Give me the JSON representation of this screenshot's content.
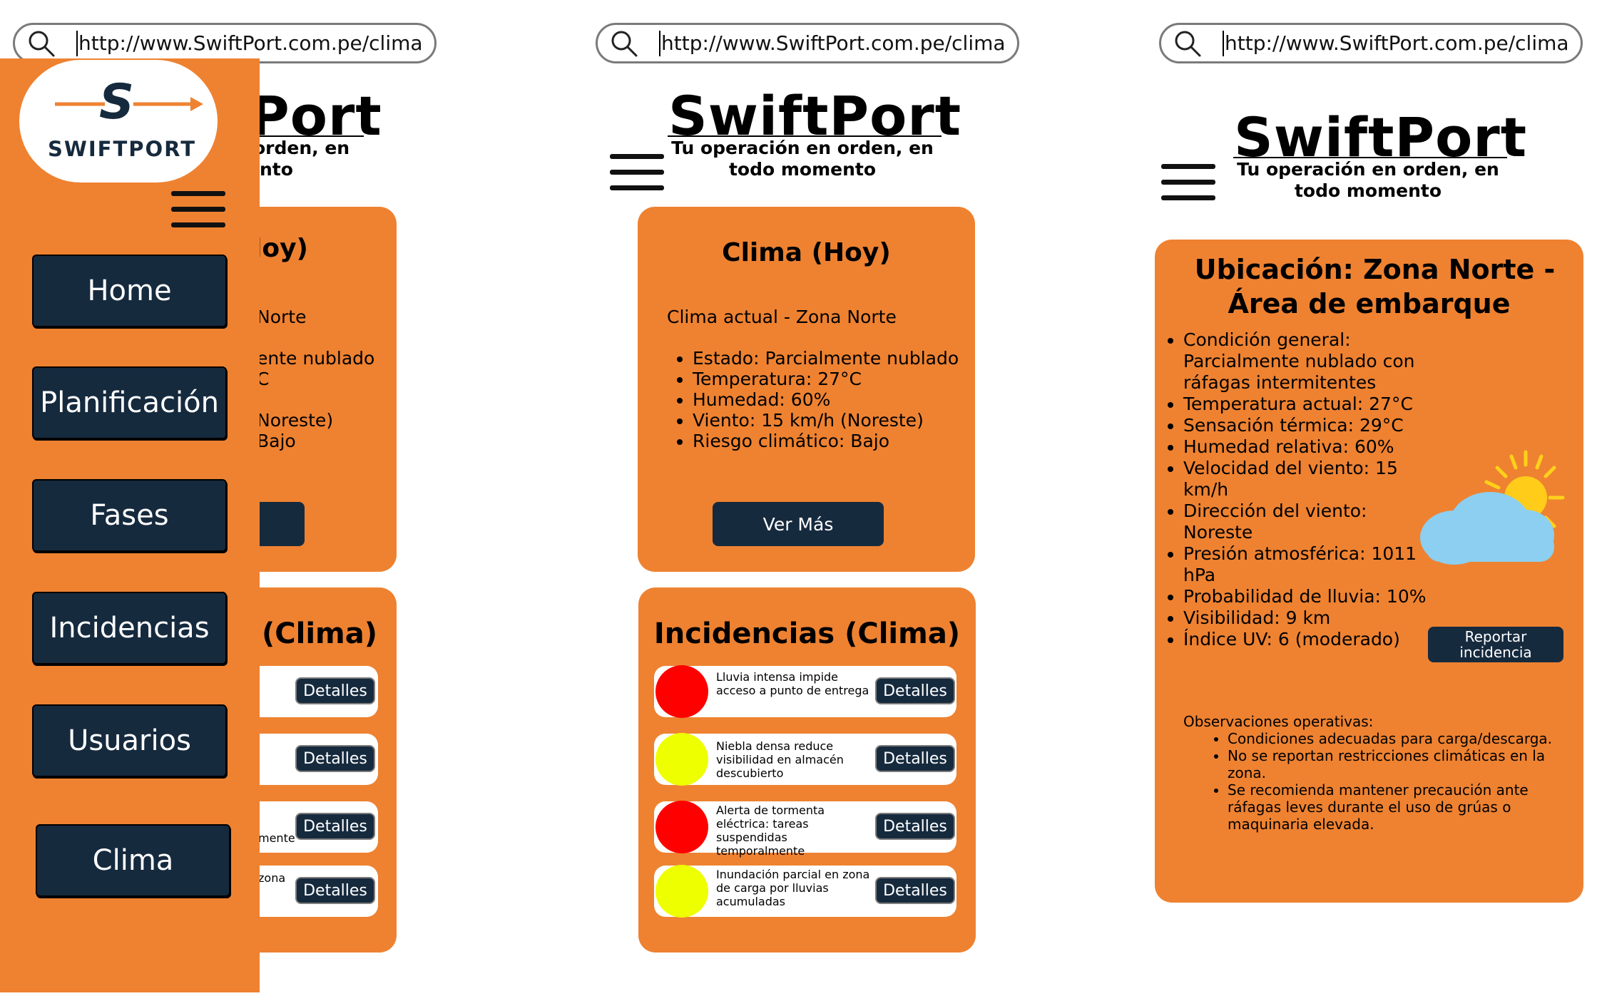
{
  "url": "http://www.SwiftPort.com.pe/clima",
  "brand": {
    "name": "SwiftPort",
    "tagline_line1": "Tu operación en orden, en",
    "tagline_line2": "todo momento",
    "logo_letter": "S",
    "logo_text": "SWIFTPORT"
  },
  "menu": {
    "items": [
      "Home",
      "Planificación",
      "Fases",
      "Incidencias",
      "Usuarios",
      "Clima"
    ]
  },
  "weather_card": {
    "title": "Clima (Hoy)",
    "subtitle": "Clima actual - Zona Norte",
    "items": [
      "Estado:  Parcialmente nublado",
      "Temperatura: 27°C",
      "Humedad: 60%",
      "Viento: 15 km/h (Noreste)",
      "Riesgo climático: Bajo"
    ],
    "button": "Ver Más"
  },
  "incidents_card": {
    "title": "Incidencias (Clima)",
    "button_label": "Detalles",
    "items": [
      {
        "text": "Lluvia intensa impide acceso a punto de entrega",
        "color": "#ff0000"
      },
      {
        "text": "Niebla densa reduce visibilidad en almacén descubierto",
        "color": "#eeff00"
      },
      {
        "text": "Alerta de tormenta eléctrica: tareas suspendidas temporalmente",
        "color": "#ff0000"
      },
      {
        "text": "Inundación parcial en zona de carga por lluvias acumuladas",
        "color": "#eeff00"
      }
    ]
  },
  "partial": {
    "title_frag": "loy)",
    "line1": "Norte",
    "line2": "ente nublado",
    "line3": "C",
    "line4": "Noreste)",
    "line5": "Bajo",
    "inc_title_frag": "(Clima)",
    "inc_frag3": "mente",
    "inc_frag4": "zona",
    "brand_frag": "Port",
    "tag_frag1": "orden, en",
    "tag_frag2": "nto"
  },
  "detail": {
    "title_line1": "Ubicación: Zona Norte -",
    "title_line2": "Área de embarque",
    "items": [
      "Condición general: Parcialmente nublado con ráfagas intermitentes",
      "Temperatura actual: 27°C",
      "Sensación térmica: 29°C",
      "Humedad relativa: 60%",
      "Velocidad del viento: 15 km/h",
      "Dirección del viento: Noreste",
      "Presión atmosférica: 1011 hPa",
      "Probabilidad de lluvia: 10%",
      "Visibilidad: 9 km",
      "Índice UV: 6 (moderado)"
    ],
    "report_button": "Reportar incidencia",
    "observations_title": "Observaciones operativas:",
    "observations": [
      "Condiciones adecuadas para carga/descarga.",
      "No se reportan restricciones climáticas en la zona.",
      "Se recomienda mantener precaución ante ráfagas leves durante el uso de grúas o maquinaria elevada."
    ]
  },
  "colors": {
    "orange": "#ee8231",
    "navy": "#162a3e",
    "alert_red": "#ff0000",
    "alert_yellow": "#eeff00"
  },
  "icons": [
    "search-icon",
    "hamburger-icon",
    "partly-cloudy-icon",
    "arrow-icon"
  ]
}
